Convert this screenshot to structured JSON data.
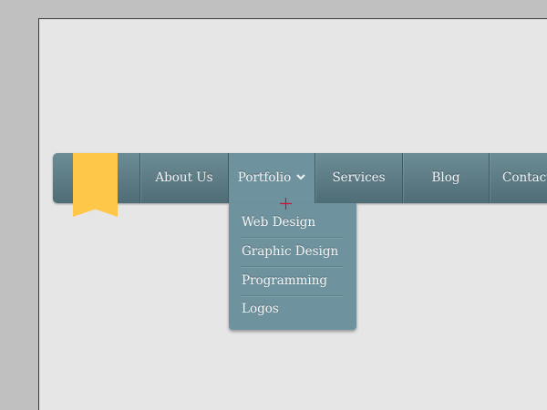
{
  "menu": {
    "items": [
      {
        "label": "About Us"
      },
      {
        "label": "Portfolio",
        "active": true,
        "icon": "chevron-down-icon"
      },
      {
        "label": "Services"
      },
      {
        "label": "Blog"
      },
      {
        "label": "Contact"
      }
    ],
    "submenu": [
      {
        "label": "Web Design"
      },
      {
        "label": "Graphic Design"
      },
      {
        "label": "Programming"
      },
      {
        "label": "Logos"
      }
    ]
  },
  "colors": {
    "bar": "#5b7a84",
    "active": "#6f939e",
    "ribbon": "#ffc74a",
    "canvas": "#e6e6e6"
  }
}
